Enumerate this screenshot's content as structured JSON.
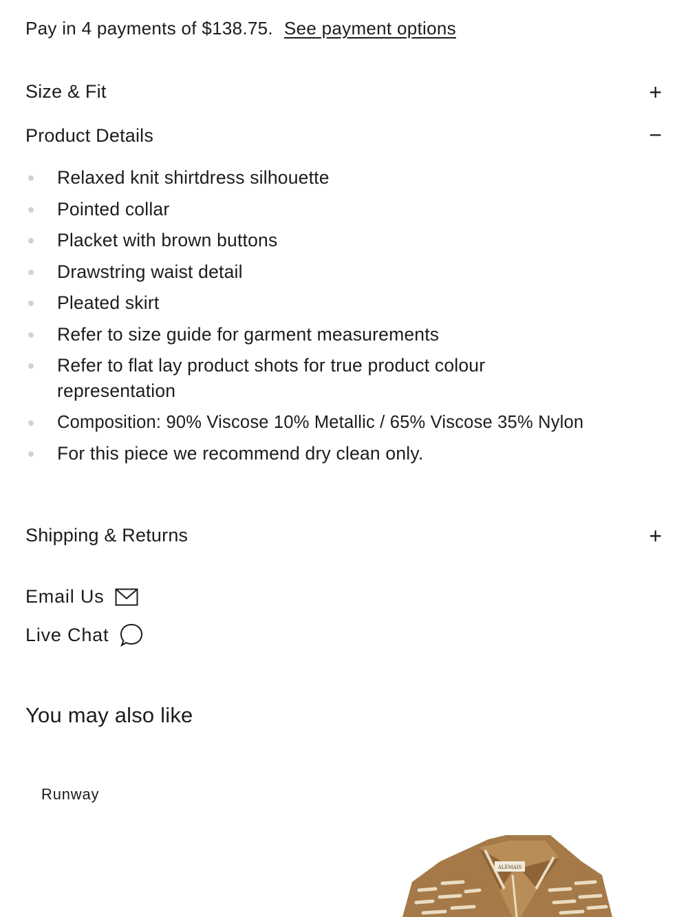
{
  "payment": {
    "text": "Pay in 4 payments of $138.75.",
    "link": "See payment options"
  },
  "accordion": {
    "size_fit": {
      "title": "Size & Fit",
      "icon": "plus-icon",
      "symbol": "+"
    },
    "product_details": {
      "title": "Product Details",
      "icon": "minus-icon",
      "symbol": "−",
      "items": [
        "Relaxed knit shirtdress silhouette",
        "Pointed collar",
        "Placket with brown buttons",
        "Drawstring waist detail",
        "Pleated skirt",
        "Refer to size guide for garment measurements",
        "Refer to flat lay product shots for true product colour representation",
        "Composition: 90% Viscose 10% Metallic / 65% Viscose 35% Nylon",
        "For this piece we recommend dry clean only."
      ]
    },
    "shipping": {
      "title": "Shipping & Returns",
      "icon": "plus-icon",
      "symbol": "+"
    }
  },
  "contact": {
    "email": {
      "label": "Email Us",
      "icon": "envelope-icon"
    },
    "chat": {
      "label": "Live Chat",
      "icon": "chat-bubble-icon"
    }
  },
  "recommendations": {
    "title": "You may also like",
    "tag": "Runway",
    "brand_label_on_garment": "ALÉMAIS"
  },
  "colors": {
    "text": "#1c1c1c",
    "bullet": "#d2d2d2",
    "garment_brown": "#a57a48",
    "garment_cream": "#eadcc2"
  }
}
